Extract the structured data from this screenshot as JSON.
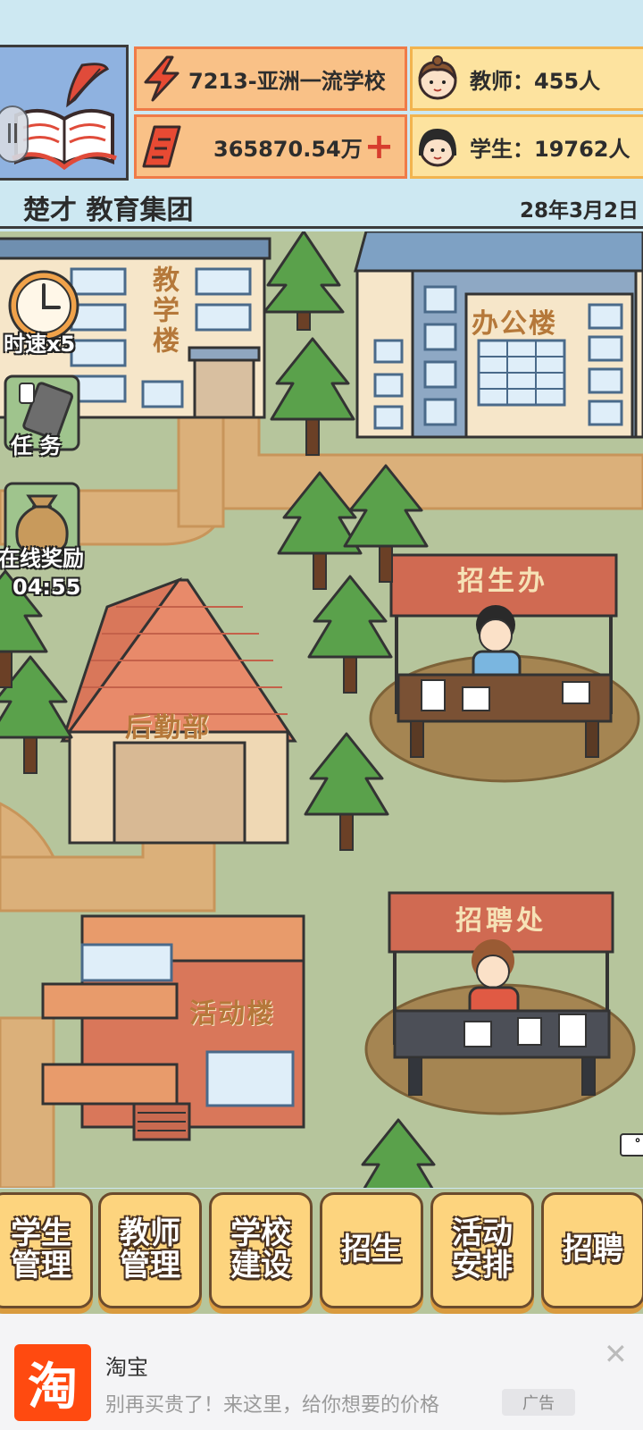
{
  "header": {
    "rank_text": "7213-亚洲一流学校",
    "money_text": "365870.54万",
    "plus_symbol": "+",
    "teacher_text": "教师：455人",
    "student_text": "学生：19762人",
    "school_name": "楚才 教育集团",
    "date": "28年3月2日"
  },
  "map": {
    "buildings": {
      "teaching": "教学楼",
      "office": "办公楼",
      "logistics": "后勤部",
      "activity": "活动楼"
    },
    "booths": {
      "admissions": "招生办",
      "recruitment": "招聘处"
    }
  },
  "widgets": {
    "speed": "时速x5",
    "tasks": "任 务",
    "online_reward": "在线奖励",
    "online_timer": "04:55"
  },
  "actions": [
    {
      "label": "学生\n管理"
    },
    {
      "label": "教师\n管理"
    },
    {
      "label": "学校\n建设"
    },
    {
      "label": "招生"
    },
    {
      "label": "活动\n安排"
    },
    {
      "label": "招聘"
    }
  ],
  "ad": {
    "logo_char": "淘",
    "title": "淘宝",
    "description": "别再买贵了！来这里，给你想要的价格",
    "tag": "广告",
    "close": "✕"
  },
  "icons": [
    "quill-book-icon",
    "lightning-icon",
    "banknote-icon",
    "teacher-avatar-icon",
    "student-avatar-icon",
    "clock-icon",
    "task-paper-icon",
    "reward-bag-icon"
  ],
  "colors": {
    "accent_orange": "#ef7b48",
    "stat_orange": "#f9c187",
    "stat_yellow": "#fde39f",
    "button_yellow": "#fdd47e",
    "map_grass": "#b6c59c",
    "ad_brand": "#ff4a10"
  }
}
